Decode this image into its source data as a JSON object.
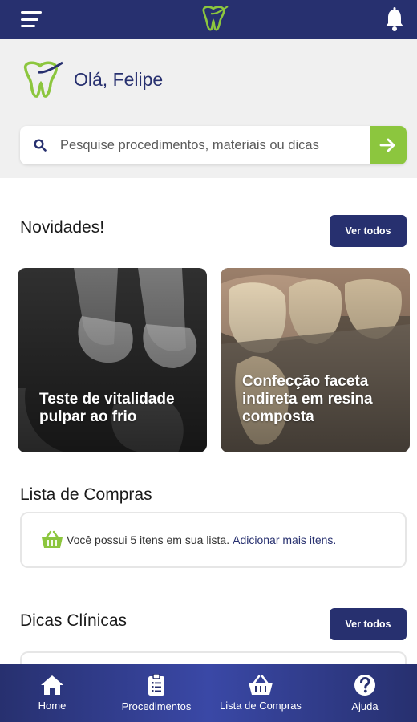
{
  "topbar": {
    "menu_icon": "hamburger-menu-icon",
    "logo_icon": "tooth-logo-icon",
    "notification_icon": "bell-icon"
  },
  "header": {
    "greeting": "Olá, Felipe",
    "logo_icon": "tooth-logo-icon"
  },
  "search": {
    "placeholder": "Pesquise procedimentos, materiais ou dicas",
    "value": "",
    "icon": "search-icon",
    "submit_icon": "arrow-right-icon"
  },
  "news": {
    "title": "Novidades!",
    "see_all_label": "Ver todos",
    "cards": [
      {
        "title": "Teste de vitalidade pulpar ao frio",
        "image": "dental-xray-image"
      },
      {
        "title": "Confecção faceta indireta em resina composta",
        "image": "tooth-veneer-image"
      }
    ]
  },
  "shopping": {
    "title": "Lista de Compras",
    "icon": "basket-icon",
    "message": "Você possui 5 itens em sua lista.",
    "link": "Adicionar mais itens."
  },
  "tips": {
    "title": "Dicas Clínicas",
    "see_all_label": "Ver todos"
  },
  "bottom_nav": {
    "items": [
      {
        "label": "Home",
        "icon": "home-icon"
      },
      {
        "label": "Procedimentos",
        "icon": "clipboard-icon"
      },
      {
        "label": "Lista de Compras",
        "icon": "basket-icon"
      },
      {
        "label": "Ajuda",
        "icon": "help-icon"
      }
    ]
  },
  "colors": {
    "primary": "#27306f",
    "accent": "#8cc63e",
    "header_bg": "#f0f0f0"
  }
}
